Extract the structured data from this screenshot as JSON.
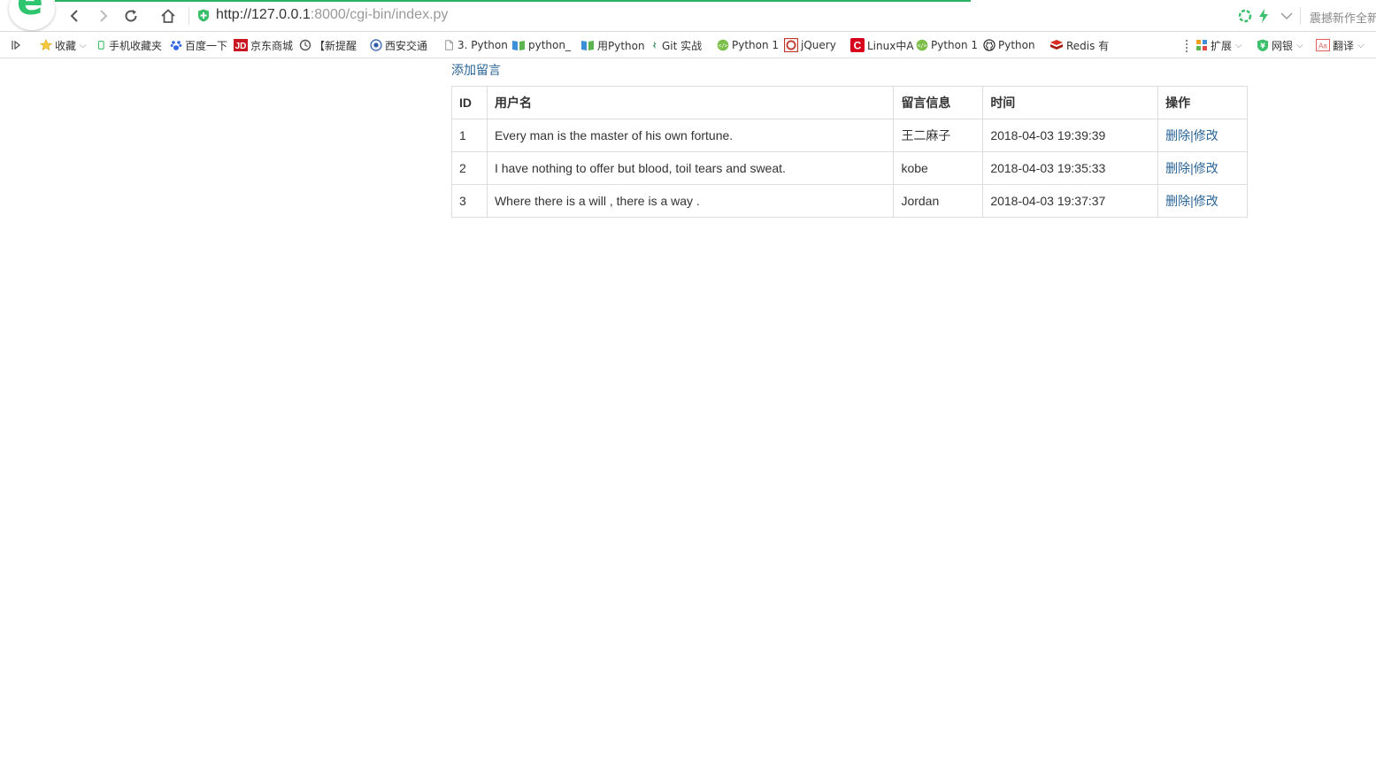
{
  "browser": {
    "url_host": "http://127.0.0.1",
    "url_path": ":8000/cgi-bin/index.py",
    "news_ticker": "震撼新作全新",
    "bookmarks": [
      {
        "label": "收藏",
        "icon": "star-icon",
        "dropdown": true
      },
      {
        "label": "手机收藏夹",
        "icon": "phone-icon"
      },
      {
        "label": "百度一下",
        "icon": "baidu-paw-icon"
      },
      {
        "label": "京东商城",
        "icon": "jd-icon"
      },
      {
        "label": "【新提醒",
        "icon": "bell-icon"
      },
      {
        "label": "西安交通",
        "icon": "xjtu-icon"
      },
      {
        "label": "3. Python",
        "icon": "document-icon"
      },
      {
        "label": "python_",
        "icon": "book-icon"
      },
      {
        "label": "用Python",
        "icon": "book-icon"
      },
      {
        "label": "Git 实战",
        "icon": "git-icon"
      },
      {
        "label": "Python 1",
        "icon": "code-icon"
      },
      {
        "label": "jQuery",
        "icon": "jquery-icon"
      },
      {
        "label": "Linux中A",
        "icon": "csdn-icon"
      },
      {
        "label": "Python 1",
        "icon": "code-icon"
      },
      {
        "label": "Python",
        "icon": "github-icon"
      },
      {
        "label": "Redis 有",
        "icon": "redis-icon"
      }
    ],
    "extensions": [
      {
        "label": "扩展",
        "icon": "extensions-icon"
      },
      {
        "label": "网银",
        "icon": "bank-icon"
      },
      {
        "label": "翻译",
        "icon": "translate-icon"
      }
    ]
  },
  "page": {
    "add_link": "添加留言",
    "table": {
      "headers": [
        "ID",
        "用户名",
        "留言信息",
        "时间",
        "操作"
      ],
      "rows": [
        {
          "id": "1",
          "message": "Every man is the master of his own fortune.",
          "user": "王二麻子",
          "time": "2018-04-03 19:39:39"
        },
        {
          "id": "2",
          "message": "I have nothing to offer but blood, toil tears and sweat.",
          "user": "kobe",
          "time": "2018-04-03 19:35:33"
        },
        {
          "id": "3",
          "message": "Where there is a will , there is a way .",
          "user": "Jordan",
          "time": "2018-04-03 19:37:37"
        }
      ],
      "delete_label": "删除",
      "separator": "|",
      "edit_label": "修改"
    }
  },
  "colors": {
    "link": "#2a6496",
    "brand_green": "#2dc66e",
    "border": "#dddddd"
  }
}
